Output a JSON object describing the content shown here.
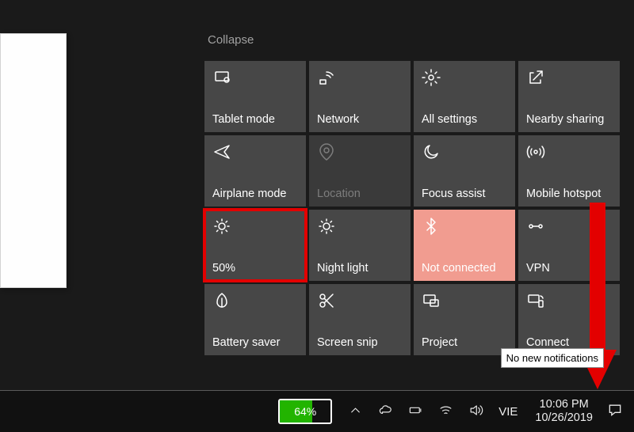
{
  "collapse_label": "Collapse",
  "tiles": [
    {
      "icon": "tablet",
      "label": "Tablet mode",
      "state": "normal"
    },
    {
      "icon": "network",
      "label": "Network",
      "state": "normal"
    },
    {
      "icon": "settings",
      "label": "All settings",
      "state": "normal"
    },
    {
      "icon": "share",
      "label": "Nearby sharing",
      "state": "normal"
    },
    {
      "icon": "airplane",
      "label": "Airplane mode",
      "state": "normal"
    },
    {
      "icon": "location",
      "label": "Location",
      "state": "disabled"
    },
    {
      "icon": "moon",
      "label": "Focus assist",
      "state": "normal"
    },
    {
      "icon": "hotspot",
      "label": "Mobile hotspot",
      "state": "normal"
    },
    {
      "icon": "sun",
      "label": "50%",
      "state": "normal",
      "highlight": true
    },
    {
      "icon": "sun",
      "label": "Night light",
      "state": "normal"
    },
    {
      "icon": "bt",
      "label": "Not connected",
      "state": "pink"
    },
    {
      "icon": "vpn",
      "label": "VPN",
      "state": "normal"
    },
    {
      "icon": "leaf",
      "label": "Battery saver",
      "state": "normal"
    },
    {
      "icon": "snip",
      "label": "Screen snip",
      "state": "normal"
    },
    {
      "icon": "project",
      "label": "Project",
      "state": "normal"
    },
    {
      "icon": "connect",
      "label": "Connect",
      "state": "normal"
    }
  ],
  "tooltip": "No new notifications",
  "taskbar": {
    "battery_percent": "64%",
    "ime": "VIE",
    "time": "10:06 PM",
    "date": "10/26/2019"
  },
  "icons": {
    "tablet": "tablet-mode-icon",
    "network": "network-icon",
    "settings": "settings-icon",
    "share": "nearby-sharing-icon",
    "airplane": "airplane-mode-icon",
    "location": "location-icon",
    "moon": "focus-assist-icon",
    "hotspot": "mobile-hotspot-icon",
    "sun": "brightness-icon",
    "bt": "bluetooth-icon",
    "vpn": "vpn-icon",
    "leaf": "battery-saver-icon",
    "snip": "screen-snip-icon",
    "project": "project-icon",
    "connect": "connect-icon"
  }
}
